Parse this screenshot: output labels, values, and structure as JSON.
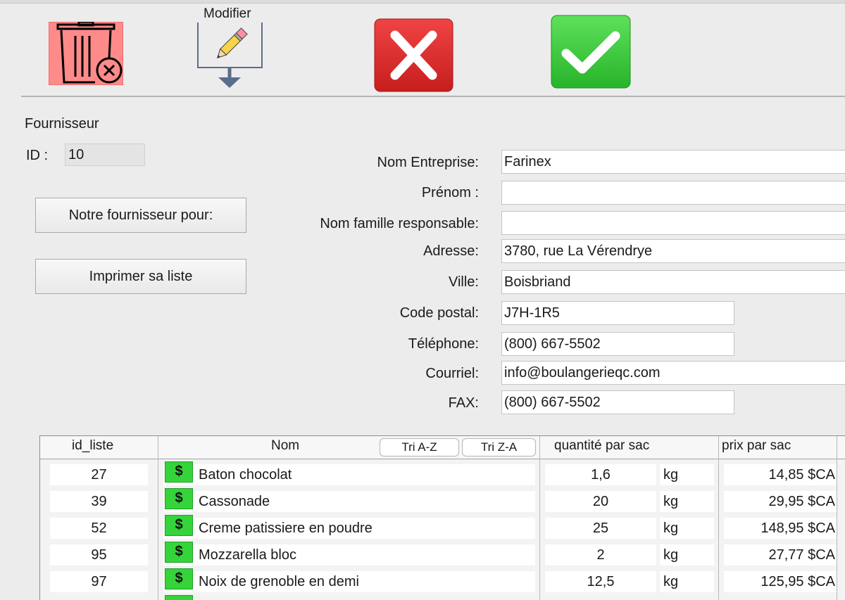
{
  "toolbar": {
    "modifier_label": "Modifier"
  },
  "colors": {
    "delete_bg": "#ff8a8a",
    "cancel_red": "#e02a2a",
    "confirm_green": "#3fcf3f",
    "dollar_green": "#34d43a"
  },
  "icons": [
    "trash-delete-icon",
    "edit-pencil-icon",
    "cancel-x-icon",
    "confirm-check-icon",
    "dollar-icon"
  ],
  "section": {
    "title": "Fournisseur"
  },
  "id_field": {
    "label": "ID :",
    "value": "10"
  },
  "buttons": {
    "notre_fournisseur": "Notre fournisseur pour:",
    "imprimer": "Imprimer sa liste"
  },
  "form": {
    "nom_entreprise": {
      "label": "Nom Entreprise:",
      "value": "Farinex"
    },
    "prenom": {
      "label": "Prénom :",
      "value": ""
    },
    "nom_famille": {
      "label": "Nom famille responsable:",
      "value": ""
    },
    "adresse": {
      "label": "Adresse:",
      "value": "3780, rue La Vérendrye"
    },
    "ville": {
      "label": "Ville:",
      "value": "Boisbriand"
    },
    "code_postal": {
      "label": "Code postal:",
      "value": "J7H-1R5"
    },
    "telephone": {
      "label": "Téléphone:",
      "value": "(800) 667-5502"
    },
    "courriel": {
      "label": "Courriel:",
      "value": "info@boulangerieqc.com"
    },
    "fax": {
      "label": "FAX:",
      "value": "(800) 667-5502"
    }
  },
  "table": {
    "headers": {
      "id_liste": "id_liste",
      "nom": "Nom",
      "quantite": "quantité par sac",
      "prix": "prix par sac"
    },
    "sort_az": "Tri A-Z",
    "sort_za": "Tri Z-A",
    "dollar_symbol": "$",
    "rows": [
      {
        "id": "27",
        "nom": "Baton chocolat",
        "qty": "1,6",
        "unit": "kg",
        "prix": "14,85 $CA"
      },
      {
        "id": "39",
        "nom": "Cassonade",
        "qty": "20",
        "unit": "kg",
        "prix": "29,95 $CA"
      },
      {
        "id": "52",
        "nom": "Creme patissiere en poudre",
        "qty": "25",
        "unit": "kg",
        "prix": "148,95 $CA"
      },
      {
        "id": "95",
        "nom": "Mozzarella bloc",
        "qty": "2",
        "unit": "kg",
        "prix": "27,77 $CA"
      },
      {
        "id": "97",
        "nom": "Noix de grenoble en demi",
        "qty": "12,5",
        "unit": "kg",
        "prix": "125,95 $CA"
      }
    ]
  }
}
